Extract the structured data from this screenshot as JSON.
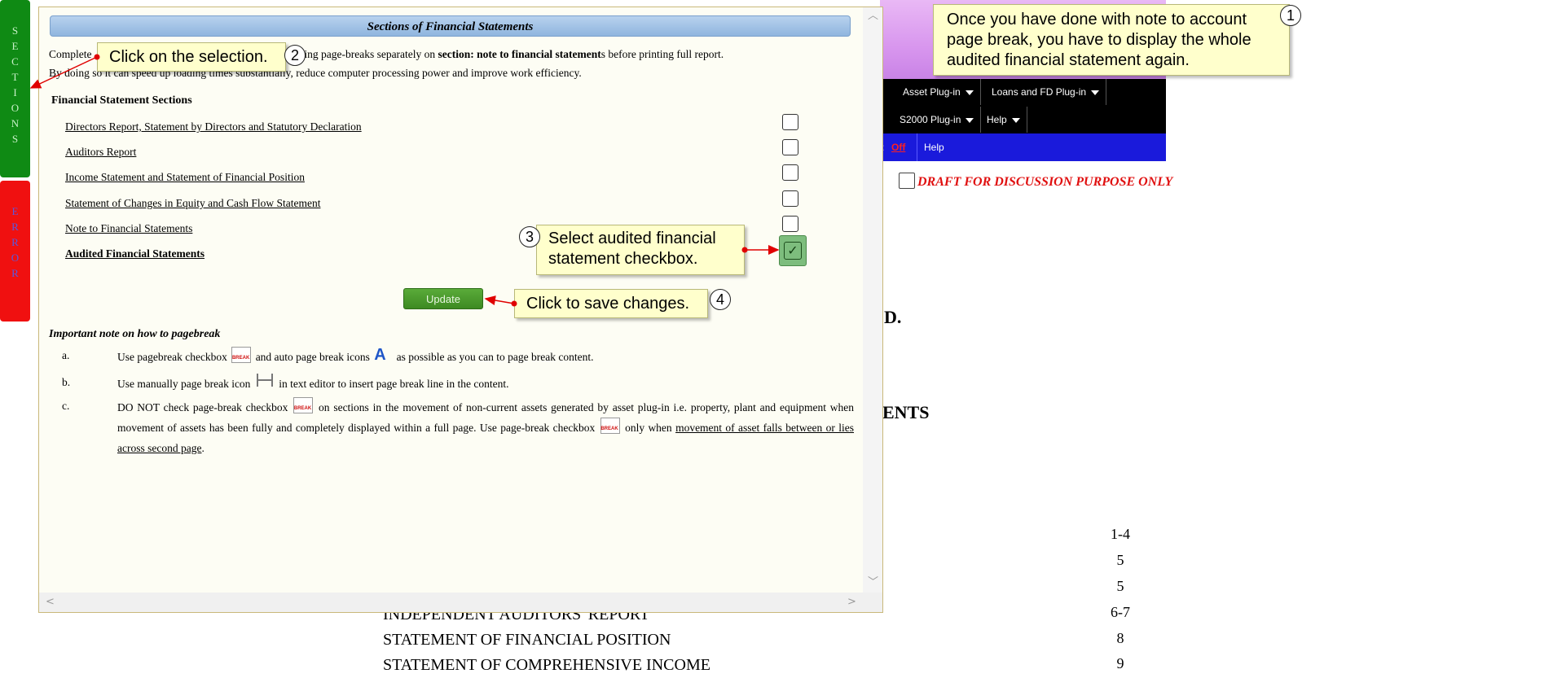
{
  "background": {
    "menu_row1": [
      "Asset Plug-in",
      "Loans and FD Plug-in"
    ],
    "menu_row2": [
      "S2000 Plug-in",
      "Help"
    ],
    "bluebar": {
      "prefix": ":",
      "off": "Off",
      "help": "Help"
    },
    "draft": "DRAFT FOR DISCUSSION PURPOSE ONLY",
    "fragment_d": "D.",
    "fragment_ents": "ENTS",
    "toc": [
      {
        "title": "",
        "page": "1-4"
      },
      {
        "title": "",
        "page": "5"
      },
      {
        "title": "",
        "page": "5"
      },
      {
        "title": "INDEPENDENT AUDITORS' REPORT",
        "page": "6-7"
      },
      {
        "title": "STATEMENT OF FINANCIAL POSITION",
        "page": "8"
      },
      {
        "title": "STATEMENT OF COMPREHENSIVE INCOME",
        "page": "9"
      }
    ]
  },
  "side_tabs": {
    "sections": [
      "S",
      "E",
      "C",
      "T",
      "I",
      "O",
      "N",
      "S"
    ],
    "error": [
      "E",
      "R",
      "R",
      "O",
      "R"
    ]
  },
  "modal": {
    "title": "Sections of Financial Statements",
    "intro_line1_a": "Complete",
    "intro_line1_b": "y configuring page-breaks separately on",
    "intro_line1_bold": "section: note to financial statement",
    "intro_line1_c": "s before printing full report.",
    "intro_line2": "By doing so it can speed up loading times substantially, reduce computer processing power and improve work efficiency.",
    "sections_heading": "Financial Statement Sections",
    "sections": [
      {
        "label": "Directors Report, Statement by Directors and Statutory Declaration",
        "checked": false,
        "bold": false
      },
      {
        "label": "Auditors Report",
        "checked": false,
        "bold": false
      },
      {
        "label": "Income Statement and Statement of Financial Position",
        "checked": false,
        "bold": false
      },
      {
        "label": "Statement of Changes in Equity and Cash Flow Statement",
        "checked": false,
        "bold": false
      },
      {
        "label": "Note to Financial Statements",
        "checked": false,
        "bold": false
      },
      {
        "label": "Audited Financial Statements",
        "checked": true,
        "bold": true
      }
    ],
    "update_label": "Update",
    "note_title": "Important note on how to pagebreak",
    "notes": {
      "a": {
        "letter": "a.",
        "t1": "Use pagebreak checkbox",
        "t2": "and auto page break icons",
        "t3": "as possible as you can to page break content."
      },
      "b": {
        "letter": "b.",
        "t1": "Use manually page break icon",
        "t2": "in text editor to insert page break line in the content."
      },
      "c": {
        "letter": "c.",
        "t1": "DO NOT check page-break checkbox",
        "t2": "on sections in the movement of non-current assets generated by asset plug-in i.e. property, plant and equipment when movement of assets has been fully and completely displayed within a full page. Use page-break checkbox",
        "t3": "only when",
        "t4": "movement of asset falls between or lies across second page",
        "t5": "."
      }
    },
    "break_icon_text": "BREAK",
    "auto_icon_glyph": "A"
  },
  "callouts": [
    {
      "step": "1",
      "text": "Once you have done with note to account page break, you have to display the whole audited financial statement again."
    },
    {
      "step": "2",
      "text": "Click on the selection."
    },
    {
      "step": "3",
      "text": "Select audited financial statement checkbox."
    },
    {
      "step": "4",
      "text": "Click to save changes."
    }
  ],
  "icons": {
    "check": "check-icon",
    "caret": "caret-down-icon"
  }
}
